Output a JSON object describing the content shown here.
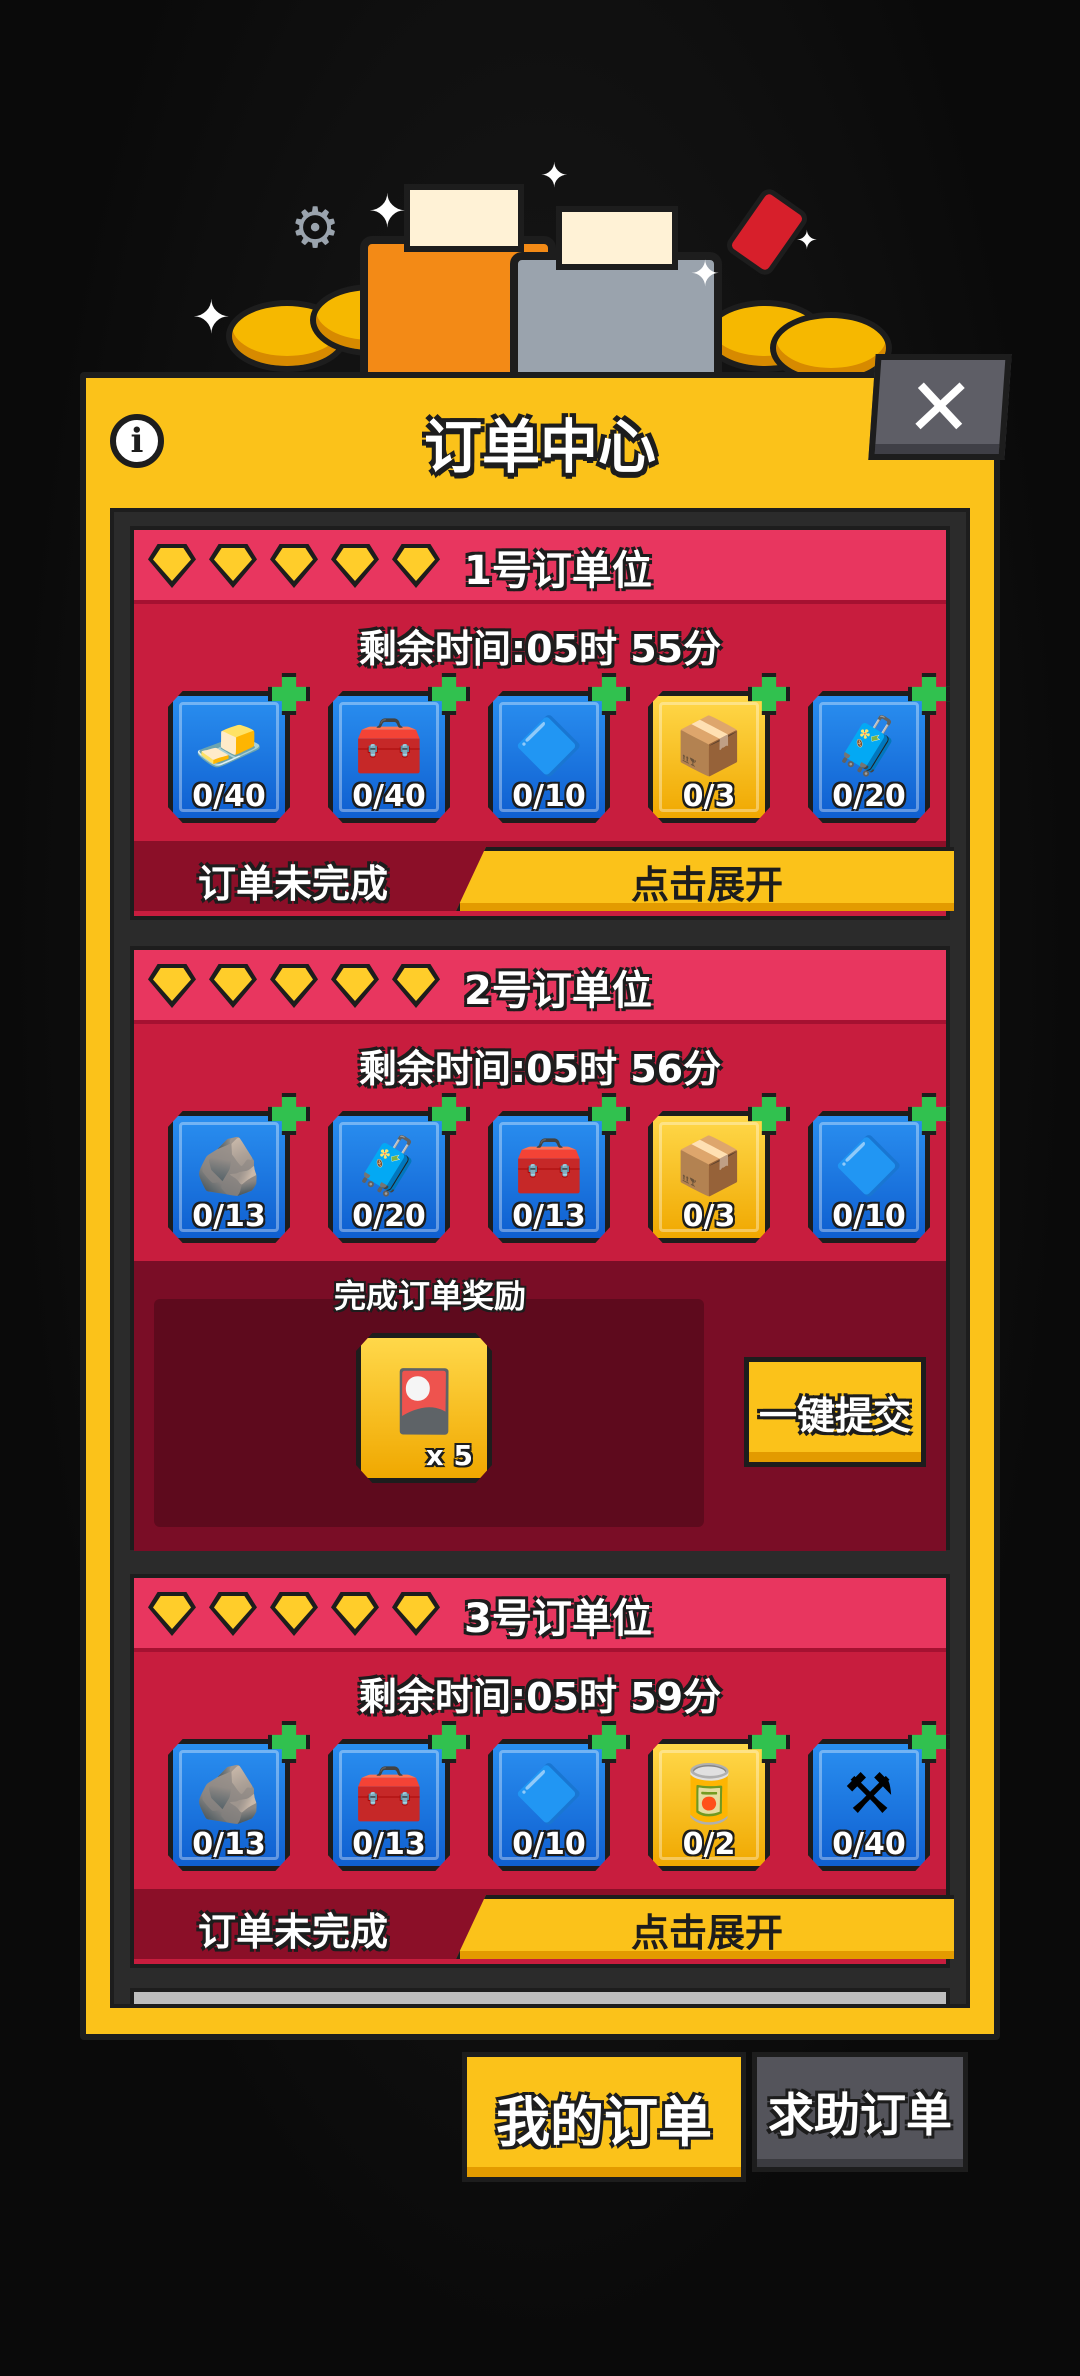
{
  "panel": {
    "title": "订单中心"
  },
  "slots": [
    {
      "title": "1号订单位",
      "timer": "剩余时间:05时 55分",
      "items": [
        {
          "icon": "gold-bar-icon",
          "glyph": "🧈",
          "count": "0/40",
          "style": "blue"
        },
        {
          "icon": "first-aid-kit-icon",
          "glyph": "🧰",
          "count": "0/40",
          "style": "blue"
        },
        {
          "icon": "blue-card-icon",
          "glyph": "🔷",
          "count": "0/10",
          "style": "blue"
        },
        {
          "icon": "pink-crate-icon",
          "glyph": "📦",
          "count": "0/3",
          "style": "gold"
        },
        {
          "icon": "purple-chest-icon",
          "glyph": "🧳",
          "count": "0/20",
          "style": "blue"
        }
      ],
      "status": "订单未完成",
      "action": "点击展开"
    },
    {
      "title": "2号订单位",
      "timer": "剩余时间:05时 56分",
      "items": [
        {
          "icon": "stone-cube-icon",
          "glyph": "🪨",
          "count": "0/13",
          "style": "blue"
        },
        {
          "icon": "purple-chest-icon",
          "glyph": "🧳",
          "count": "0/20",
          "style": "blue"
        },
        {
          "icon": "green-toolbox-icon",
          "glyph": "🧰",
          "count": "0/13",
          "style": "blue"
        },
        {
          "icon": "pink-crate-icon",
          "glyph": "📦",
          "count": "0/3",
          "style": "gold"
        },
        {
          "icon": "blue-card-icon",
          "glyph": "🔷",
          "count": "0/10",
          "style": "blue"
        }
      ],
      "reward_label": "完成订单奖励",
      "reward_icon": "character-ticket-icon",
      "reward_count": "x 5",
      "submit": "一键提交"
    },
    {
      "title": "3号订单位",
      "timer": "剩余时间:05时 59分",
      "items": [
        {
          "icon": "stone-cube-icon",
          "glyph": "🪨",
          "count": "0/13",
          "style": "blue"
        },
        {
          "icon": "green-toolbox-icon",
          "glyph": "🧰",
          "count": "0/13",
          "style": "blue"
        },
        {
          "icon": "blue-card-icon",
          "glyph": "🔷",
          "count": "0/10",
          "style": "blue"
        },
        {
          "icon": "red-canister-icon",
          "glyph": "🥫",
          "count": "0/2",
          "style": "gold"
        },
        {
          "icon": "anvil-icon",
          "glyph": "⚒",
          "count": "0/40",
          "style": "blue"
        }
      ],
      "status": "订单未完成",
      "action": "点击展开"
    }
  ],
  "tabs": {
    "my_orders": "我的订单",
    "help_orders": "求助订单"
  },
  "colors": {
    "panel": "#fbc21a",
    "slot": "#c81d3e",
    "slot_header": "#e8365f",
    "item_blue": "#1f78e6",
    "item_gold": "#f6c12a",
    "plus": "#31c14f"
  }
}
